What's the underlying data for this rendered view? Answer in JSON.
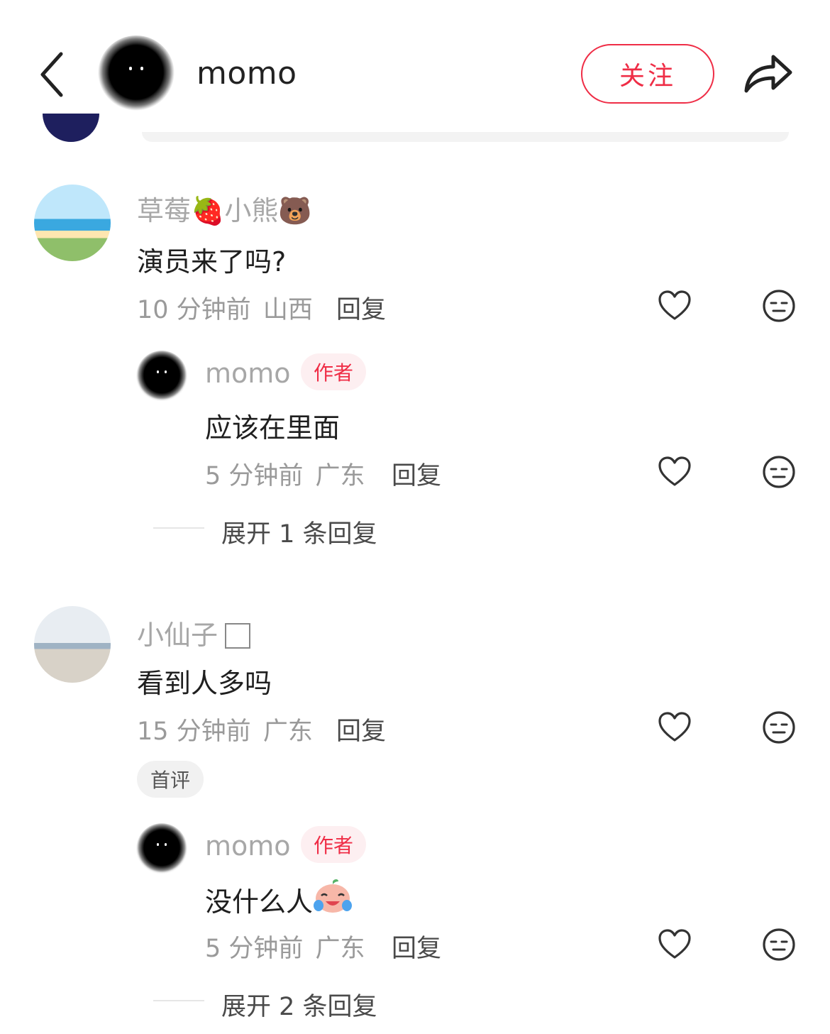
{
  "header": {
    "author_name": "momo",
    "follow_label": "关注"
  },
  "comments": [
    {
      "user": "草莓🍓小熊🐻",
      "text": "演员来了吗?",
      "time": "10 分钟前",
      "region": "山西",
      "reply_label": "回复",
      "replies": [
        {
          "user": "momo",
          "badge": "作者",
          "text": "应该在里面",
          "time": "5 分钟前",
          "region": "广东",
          "reply_label": "回复"
        }
      ],
      "expand_label": "展开 1 条回复"
    },
    {
      "user": "小仙子",
      "text": "看到人多吗",
      "time": "15 分钟前",
      "region": "广东",
      "reply_label": "回复",
      "tag": "首评",
      "replies": [
        {
          "user": "momo",
          "badge": "作者",
          "text": "没什么人",
          "time": "5 分钟前",
          "region": "广东",
          "reply_label": "回复"
        }
      ],
      "expand_label": "展开 2 条回复"
    }
  ],
  "icons": [
    "back-chevron-icon",
    "share-arrow-icon",
    "heart-icon",
    "meh-face-icon"
  ],
  "colors": {
    "accent": "#ef2d46"
  }
}
